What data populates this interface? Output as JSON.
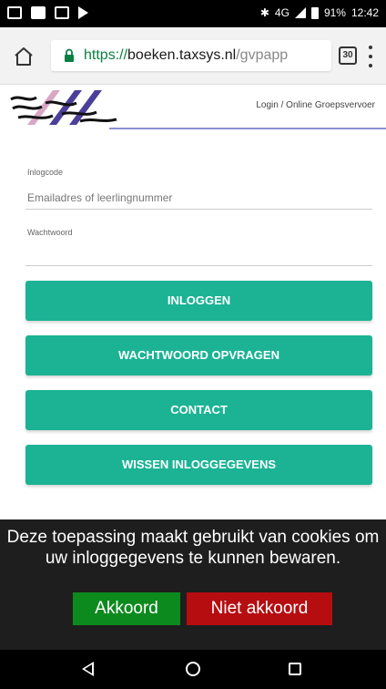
{
  "status_bar": {
    "battery_percent": "91%",
    "time": "12:42",
    "network": "4G"
  },
  "browser": {
    "url_secure": "https://",
    "url_host": "boeken.taxsys.nl",
    "url_path": "/gvpapp",
    "tabs_count": "30"
  },
  "header": {
    "tagline": "Login / Online Groepsvervoer"
  },
  "form": {
    "login_label": "Inlogcode",
    "login_placeholder": "Emailadres of leerlingnummer",
    "password_label": "Wachtwoord",
    "password_value": ""
  },
  "buttons": {
    "login": "INLOGGEN",
    "request_password": "WACHTWOORD OPVRAGEN",
    "contact": "CONTACT",
    "clear_credentials": "WISSEN INLOGGEGEVENS"
  },
  "cookie": {
    "message": "Deze toepassing maakt gebruikt van cookies om uw inloggegevens te kunnen bewaren.",
    "accept": "Akkoord",
    "decline": "Niet akkoord"
  },
  "colors": {
    "primary_button": "#1bb394",
    "accept_button": "#0d8a1e",
    "decline_button": "#b60d10",
    "cookie_background": "#1e1e1e"
  }
}
